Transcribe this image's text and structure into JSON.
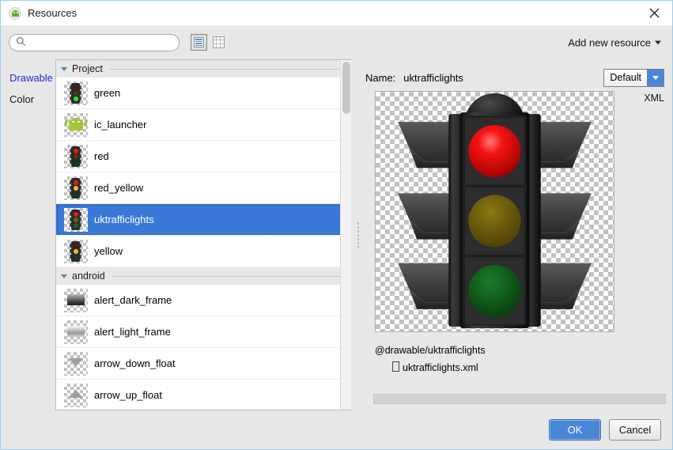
{
  "window": {
    "title": "Resources",
    "icon": "android-studio-icon",
    "close_icon": "close-icon",
    "border_color": "#9ccdf0"
  },
  "toolbar": {
    "search": {
      "value": "",
      "placeholder": "",
      "icon": "search-icon"
    },
    "view_list_label": "list-view-icon",
    "view_grid_label": "grid-view-icon",
    "view_mode_selected": "list",
    "add_new_resource": "Add new resource"
  },
  "side_tabs": [
    {
      "label": "Drawable",
      "selected": true
    },
    {
      "label": "Color",
      "selected": false
    }
  ],
  "groups": [
    {
      "name": "Project",
      "expanded": true,
      "items": [
        {
          "label": "green",
          "icon": "traffic-light-green-icon"
        },
        {
          "label": "ic_launcher",
          "icon": "android-robot-icon"
        },
        {
          "label": "red",
          "icon": "traffic-light-red-icon"
        },
        {
          "label": "red_yellow",
          "icon": "traffic-light-red-yellow-icon"
        },
        {
          "label": "uktrafficlights",
          "icon": "traffic-light-icon",
          "selected": true
        },
        {
          "label": "yellow",
          "icon": "traffic-light-yellow-icon"
        }
      ]
    },
    {
      "name": "android",
      "expanded": true,
      "items": [
        {
          "label": "alert_dark_frame",
          "icon": "alert-dark-frame-icon"
        },
        {
          "label": "alert_light_frame",
          "icon": "alert-light-frame-icon"
        },
        {
          "label": "arrow_down_float",
          "icon": "arrow-down-float-icon"
        },
        {
          "label": "arrow_up_float",
          "icon": "arrow-up-float-icon"
        }
      ]
    }
  ],
  "details": {
    "name_label": "Name:",
    "name_value": "uktrafficlights",
    "qualifier_selected": "Default",
    "file_type_label": "XML",
    "resource_reference": "@drawable/uktrafficlights",
    "resource_file": "uktrafficlights.xml",
    "preview_alt": "traffic-light-preview"
  },
  "footer": {
    "ok": "OK",
    "cancel": "Cancel"
  },
  "colors": {
    "selection_blue": "#3a78d8",
    "accent_blue": "#4a86d8",
    "link_blue": "#2a2ade",
    "panel_grey": "#e8e8e8"
  }
}
